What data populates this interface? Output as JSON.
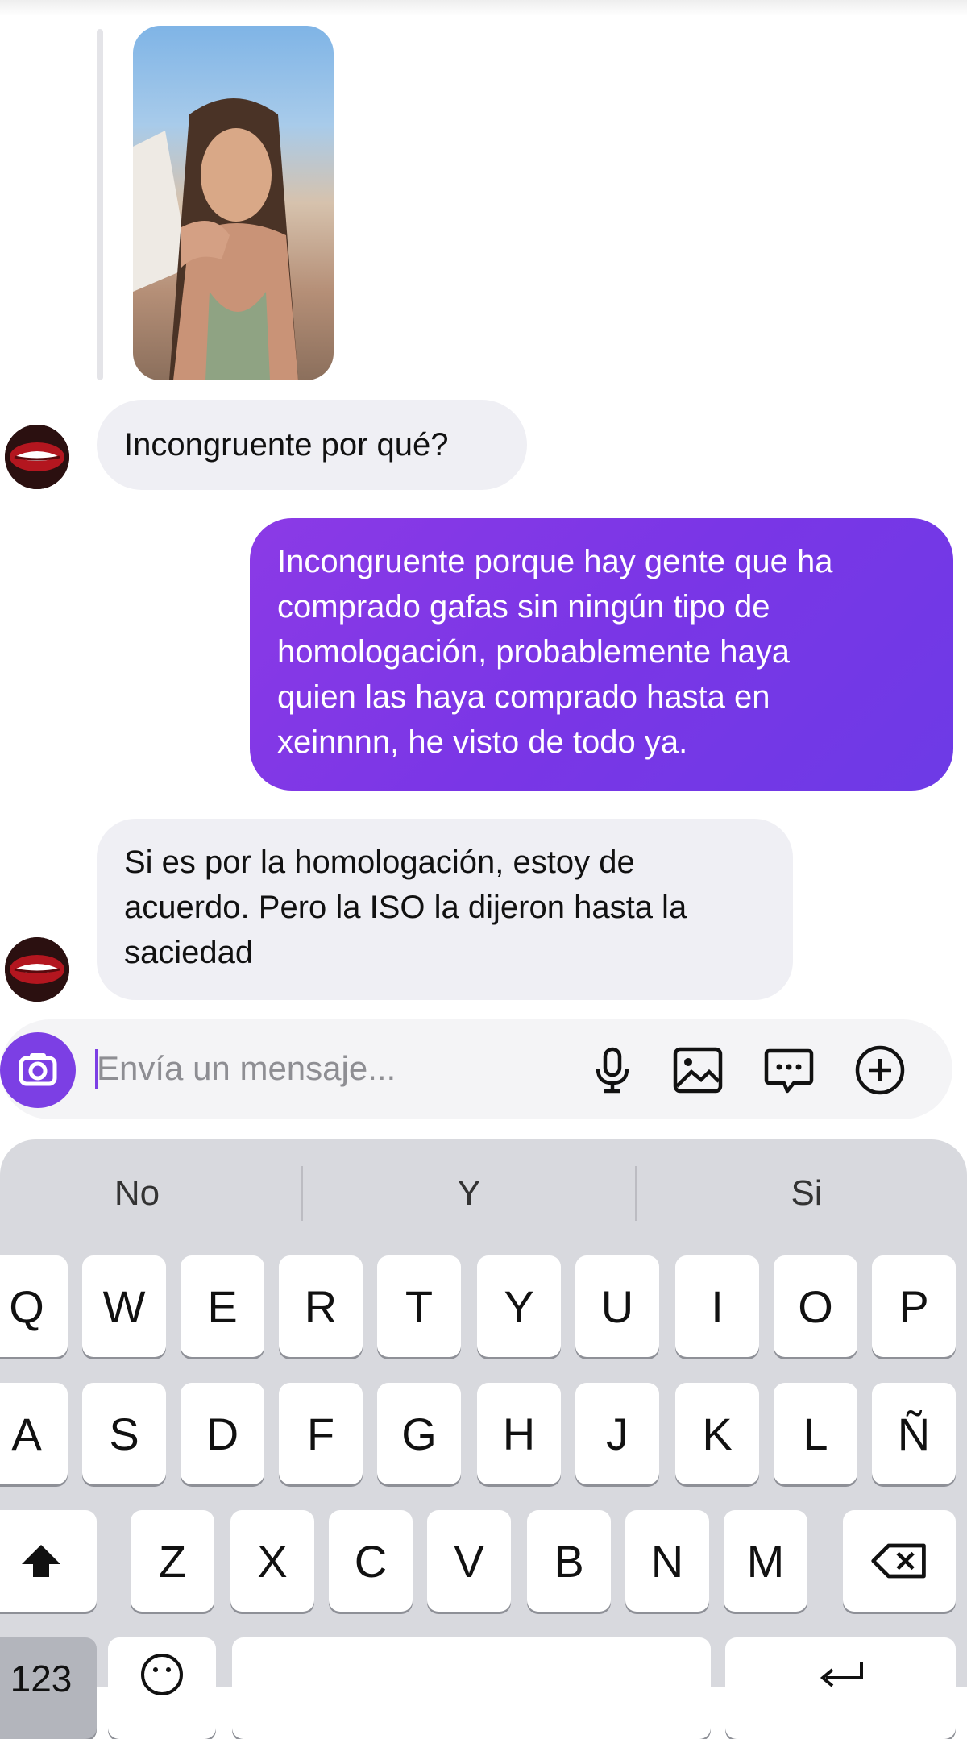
{
  "thread": {
    "messages": [
      {
        "from": "other",
        "text": "Incongruente por qué?"
      },
      {
        "from": "me",
        "text": "Incongruente porque hay gente que ha\ncomprado gafas sin ningún tipo de\nhomologación, probablemente haya\nquien las haya comprado hasta en\nxeinnnn, he visto de todo ya."
      },
      {
        "from": "other",
        "text": "Si es por la homologación, estoy de\nacuerdo. Pero la ISO la dijeron hasta la\nsaciedad"
      }
    ]
  },
  "composer": {
    "placeholder": "Envía un mensaje...",
    "icons": [
      "camera-icon",
      "microphone-icon",
      "image-icon",
      "sticker-chat-icon",
      "plus-circle-icon"
    ]
  },
  "keyboard": {
    "suggestions": [
      "No",
      "Y",
      "Si"
    ],
    "row1": [
      "Q",
      "W",
      "E",
      "R",
      "T",
      "Y",
      "U",
      "I",
      "O",
      "P"
    ],
    "row2": [
      "A",
      "S",
      "D",
      "F",
      "G",
      "H",
      "J",
      "K",
      "L",
      "Ñ"
    ],
    "row3": [
      "Z",
      "X",
      "C",
      "V",
      "B",
      "N",
      "M"
    ],
    "numbers_label": "123"
  },
  "colors": {
    "accent": "#7c3fe4",
    "outgoing_bubble": "#7a36e6",
    "incoming_bubble": "#efeff4",
    "keyboard_bg": "#d8d9de"
  }
}
